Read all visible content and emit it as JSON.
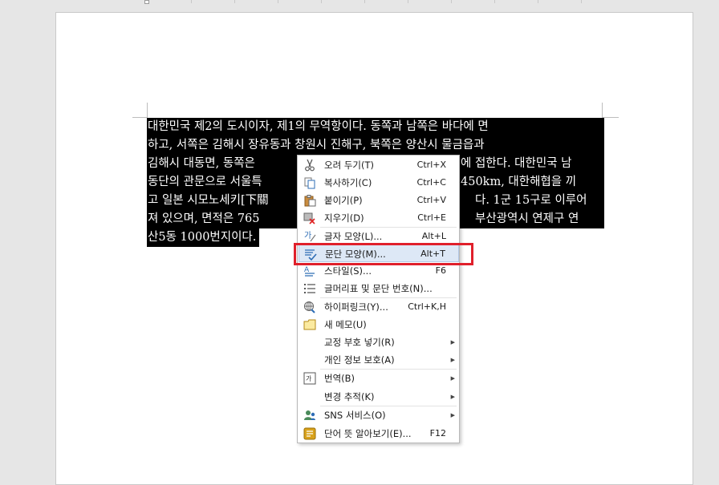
{
  "document": {
    "lines": [
      "대한민국 제2의 도시이자, 제1의 무역항이다. 동쪽과 남쪽은 바다에 면",
      "하고, 서쪽은 김해시 장유동과 창원시 진해구, 북쪽은 양산시 물금읍과",
      "김해시 대동면, 동쪽은 ",
      "동단의 관문으로 서울특",
      "고 일본 시모노세키[下關",
      "져 있으며, 면적은 765",
      "산5동 1000번지이다."
    ],
    "partials": {
      "line3_right": "에 접한다. 대한민국 남",
      "line4_right": "450km, 대한해협을 끼",
      "line5_right": "다. 1군 15구로 이루어",
      "line6_right": "부산광역시 연제구 연"
    }
  },
  "context_menu": {
    "items": [
      {
        "label": "오려 두기(T)",
        "shortcut": "Ctrl+X",
        "icon": "scissors-icon"
      },
      {
        "label": "복사하기(C)",
        "shortcut": "Ctrl+C",
        "icon": "copy-icon"
      },
      {
        "label": "붙이기(P)",
        "shortcut": "Ctrl+V",
        "icon": "paste-icon"
      },
      {
        "label": "지우기(D)",
        "shortcut": "Ctrl+E",
        "icon": "erase-icon"
      },
      {
        "label": "글자 모양(L)...",
        "shortcut": "Alt+L",
        "icon": "char-shape-icon"
      },
      {
        "label": "문단 모양(M)...",
        "shortcut": "Alt+T",
        "icon": "paragraph-shape-icon"
      },
      {
        "label": "스타일(S)...",
        "shortcut": "F6",
        "icon": "style-icon"
      },
      {
        "label": "글머리표 및 문단 번호(N)...",
        "shortcut": "",
        "icon": "bullet-list-icon"
      },
      {
        "label": "하이퍼링크(Y)...",
        "shortcut": "Ctrl+K,H",
        "icon": "hyperlink-icon"
      },
      {
        "label": "새 메모(U)",
        "shortcut": "",
        "icon": "memo-icon"
      },
      {
        "label": "교정 부호 넣기(R)",
        "shortcut": "",
        "icon": ""
      },
      {
        "label": "개인 정보 보호(A)",
        "shortcut": "",
        "icon": ""
      },
      {
        "label": "번역(B)",
        "shortcut": "",
        "icon": "translate-icon"
      },
      {
        "label": "변경 추적(K)",
        "shortcut": "",
        "icon": ""
      },
      {
        "label": "SNS 서비스(O)",
        "shortcut": "",
        "icon": "sns-icon"
      },
      {
        "label": "단어 뜻 알아보기(E)...",
        "shortcut": "F12",
        "icon": "dictionary-icon"
      }
    ],
    "highlight_color": "#dde8f6",
    "annotation_color": "#e0202b"
  }
}
